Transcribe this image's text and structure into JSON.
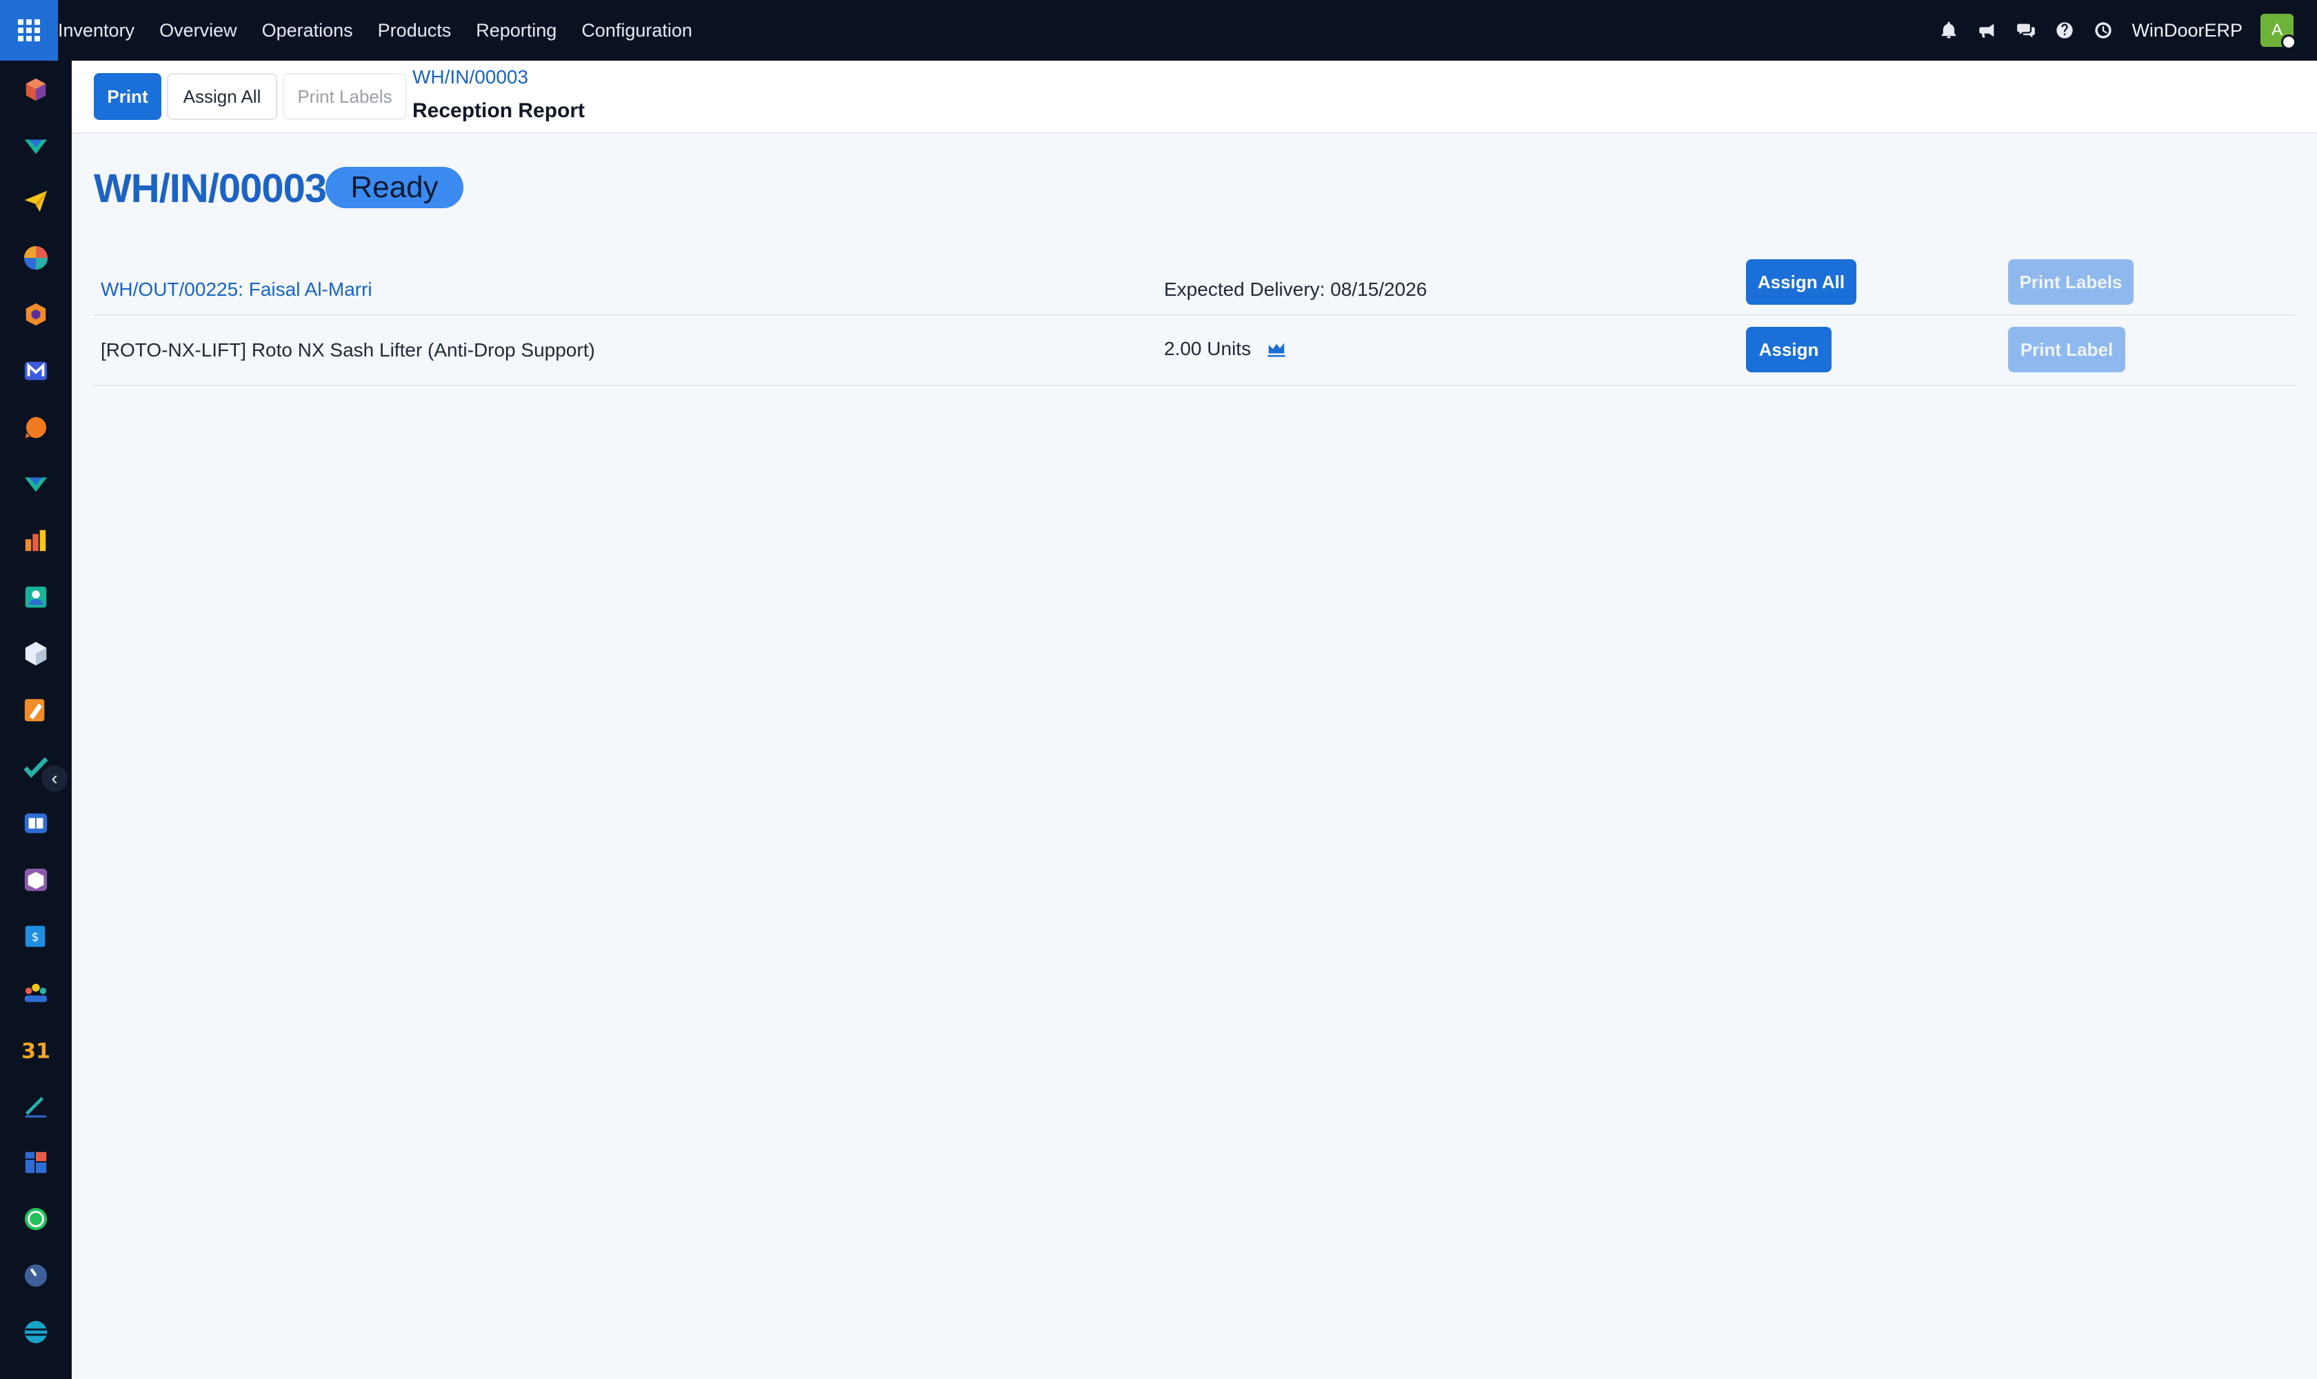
{
  "topbar": {
    "menu": [
      "Inventory",
      "Overview",
      "Operations",
      "Products",
      "Reporting",
      "Configuration"
    ],
    "company": "WinDoorERP",
    "avatar_letter": "A",
    "icons": [
      "apps-grid-icon",
      "bell-icon",
      "megaphone-icon",
      "chat-icon",
      "help-icon",
      "clock-icon"
    ]
  },
  "sidebar": {
    "icons": [
      "discuss-app-icon",
      "inventory-app-icon",
      "email-app-icon",
      "dashboard-app-icon",
      "purchase-app-icon",
      "mail-app-icon",
      "livechat-app-icon",
      "inventory-app-icon-2",
      "reports-app-icon",
      "contacts-app-icon",
      "products-app-icon",
      "studio-app-icon",
      "project-app-icon",
      "knowledge-app-icon",
      "package-app-icon",
      "invoicing-app-icon",
      "employees-app-icon",
      "calendar-app-icon",
      "sign-app-icon",
      "spreadsheet-app-icon",
      "whatsapp-app-icon",
      "timer-app-icon",
      "website-app-icon"
    ],
    "calendar_text": "31"
  },
  "control": {
    "print": "Print",
    "assign_all": "Assign All",
    "print_labels": "Print Labels",
    "breadcrumb_link": "WH/IN/00003",
    "breadcrumb_title": "Reception Report"
  },
  "report": {
    "title": "WH/IN/00003",
    "state": "Ready",
    "header_row": {
      "document": "WH/OUT/00225: Faisal Al-Marri",
      "expected": "Expected Delivery: 08/15/2026",
      "assign_all": "Assign All",
      "print_labels": "Print Labels"
    },
    "line": {
      "product": "[ROTO-NX-LIFT] Roto NX Sash Lifter (Anti-Drop Support)",
      "quantity": "2.00 Units",
      "assign": "Assign",
      "print_label": "Print Label"
    }
  },
  "colors": {
    "topbar_bg": "#0a1222",
    "primary": "#1a6fd8",
    "badge_ready": "#3b8af0",
    "link": "#1863c4"
  }
}
